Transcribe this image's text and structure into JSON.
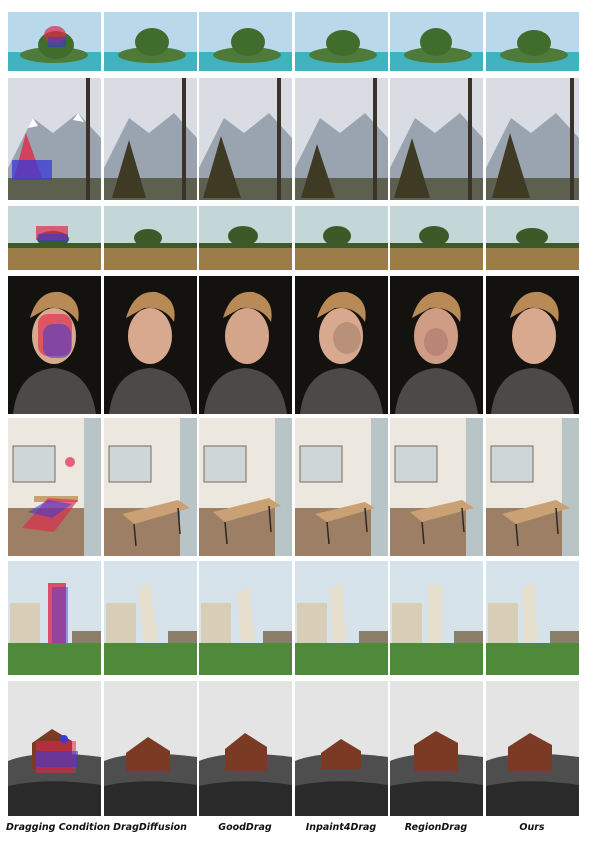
{
  "columns": [
    {
      "label": "Dragging Condition"
    },
    {
      "label": "DragDiffusion"
    },
    {
      "label": "GoodDrag"
    },
    {
      "label": "Inpaint4Drag"
    },
    {
      "label": "RegionDrag"
    },
    {
      "label": "Ours"
    }
  ],
  "rows": [
    {
      "scene": "rock-island"
    },
    {
      "scene": "snowy-mountain-tree"
    },
    {
      "scene": "field-bush"
    },
    {
      "scene": "boy-portrait"
    },
    {
      "scene": "dining-room"
    },
    {
      "scene": "leaning-tower"
    },
    {
      "scene": "cabin-on-hill"
    }
  ],
  "colors": {
    "drag_source_red": "#e0284a",
    "drag_target_blue": "#3a3ad8"
  }
}
